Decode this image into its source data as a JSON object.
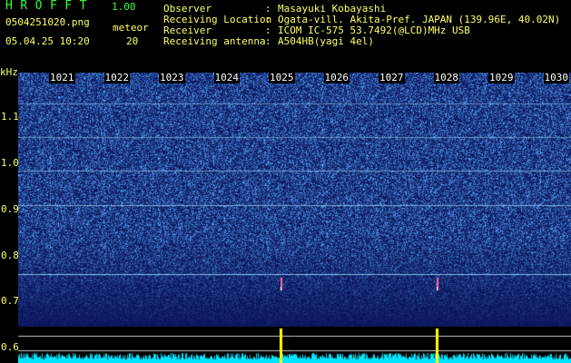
{
  "header": {
    "app_title": "HROFFT",
    "app_version": "1.00",
    "file_name": "0504251020.png",
    "date_time": "05.04.25 10:20",
    "meteor_label": "meteor",
    "meteor_count": "20"
  },
  "station": {
    "observer_label": "Observer",
    "observer_value": "Masayuki Kobayashi",
    "location_label": "Receiving Location",
    "location_value": "Ogata-vill. Akita-Pref. JAPAN (139.96E, 40.02N)",
    "receiver_label": "Receiver",
    "receiver_value": "ICOM IC-575 53.7492(@LCD)MHz USB",
    "antenna_label": "Receiving antenna",
    "antenna_value": "A504HB(yagi 4el)",
    "colon": ":"
  },
  "axis": {
    "unit": "kHz",
    "y_ticks": [
      "1.1",
      "1.0",
      "0.9",
      "0.8",
      "0.7",
      "0.6"
    ],
    "time_ticks": [
      "1021",
      "1022",
      "1023",
      "1024",
      "1025",
      "1026",
      "1027",
      "1028",
      "1029",
      "1030"
    ]
  },
  "colors": {
    "background": "#000000",
    "noise_dark": "#0a1a6e",
    "noise_bright": "#4aa0ff",
    "signal_line": "#9fd8ff",
    "meteor_trace": "#ff66aa",
    "power_trace": "#00e5ff",
    "meteor_peak": "#ffff00"
  },
  "spectrogram": {
    "meteor_events_at_minute": [
      "1025",
      "1028"
    ]
  }
}
